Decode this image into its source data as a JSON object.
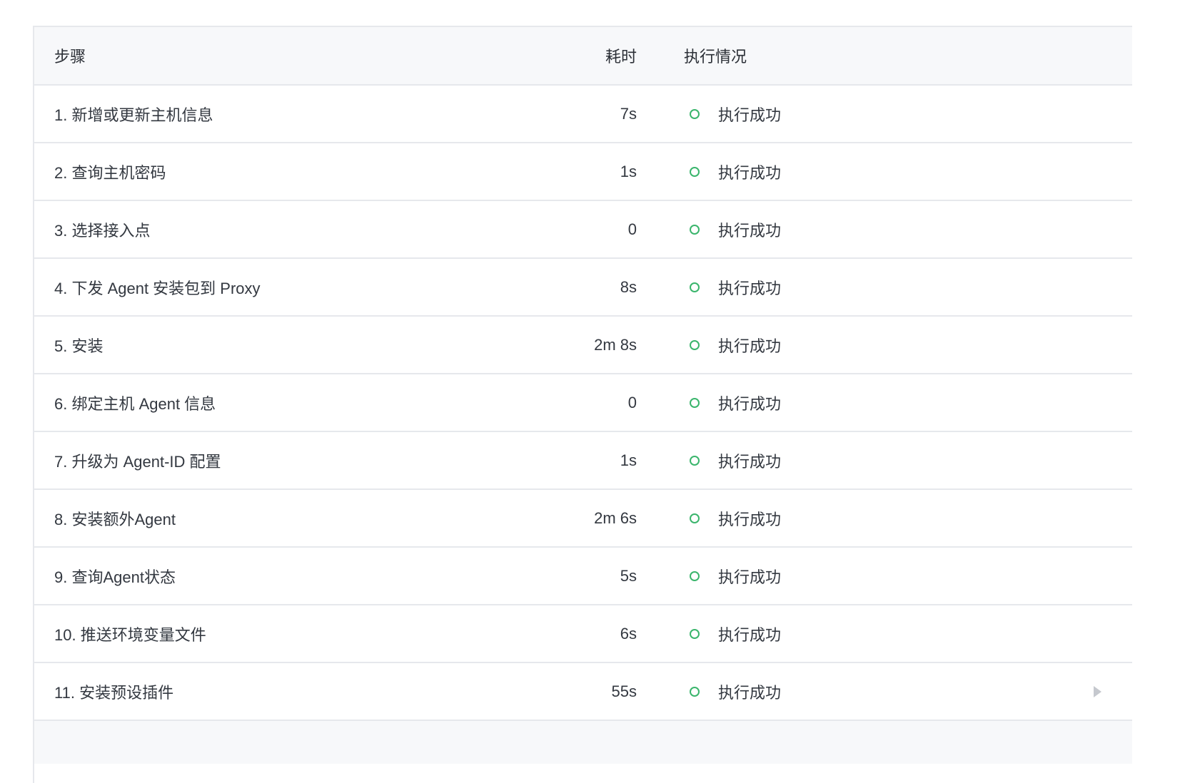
{
  "table": {
    "headers": {
      "step": "步骤",
      "duration": "耗时",
      "status": "执行情况"
    },
    "rows": [
      {
        "step": "1. 新增或更新主机信息",
        "duration": "7s",
        "status": "执行成功"
      },
      {
        "step": "2. 查询主机密码",
        "duration": "1s",
        "status": "执行成功"
      },
      {
        "step": "3. 选择接入点",
        "duration": "0",
        "status": "执行成功"
      },
      {
        "step": "4. 下发 Agent 安装包到 Proxy",
        "duration": "8s",
        "status": "执行成功"
      },
      {
        "step": "5. 安装",
        "duration": "2m 8s",
        "status": "执行成功"
      },
      {
        "step": "6. 绑定主机 Agent 信息",
        "duration": "0",
        "status": "执行成功"
      },
      {
        "step": "7. 升级为 Agent-ID 配置",
        "duration": "1s",
        "status": "执行成功"
      },
      {
        "step": "8. 安装额外Agent",
        "duration": "2m 6s",
        "status": "执行成功"
      },
      {
        "step": "9. 查询Agent状态",
        "duration": "5s",
        "status": "执行成功"
      },
      {
        "step": "10. 推送环境变量文件",
        "duration": "6s",
        "status": "执行成功"
      },
      {
        "step": "11. 安装预设插件",
        "duration": "55s",
        "status": "执行成功"
      }
    ]
  },
  "colors": {
    "success": "#3ab56c",
    "border": "#e6e8ec",
    "header_bg": "#f7f8fa"
  },
  "icons": {
    "status": "success-circle-icon",
    "expand": "caret-right-icon"
  }
}
